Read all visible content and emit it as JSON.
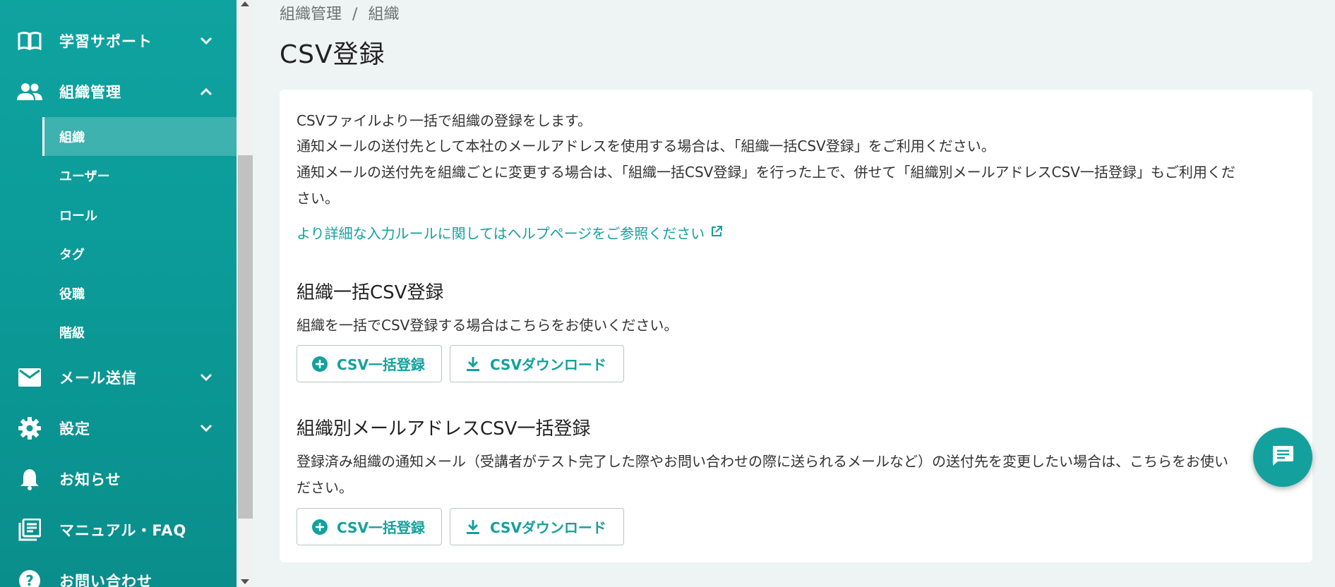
{
  "sidebar": {
    "groups": [
      {
        "label": "学習サポート",
        "icon": "book-icon",
        "expanded": false
      },
      {
        "label": "組織管理",
        "icon": "people-icon",
        "expanded": true
      },
      {
        "label": "メール送信",
        "icon": "mail-icon",
        "expanded": false
      },
      {
        "label": "設定",
        "icon": "gear-icon",
        "expanded": false
      },
      {
        "label": "お知らせ",
        "icon": "bell-icon"
      },
      {
        "label": "マニュアル・FAQ",
        "icon": "manual-icon"
      },
      {
        "label": "お問い合わせ",
        "icon": "help-icon"
      }
    ],
    "sub_items": [
      {
        "label": "組織",
        "active": true
      },
      {
        "label": "ユーザー"
      },
      {
        "label": "ロール"
      },
      {
        "label": "タグ"
      },
      {
        "label": "役職"
      },
      {
        "label": "階級"
      }
    ]
  },
  "breadcrumb": {
    "parent": "組織管理",
    "separator": "/",
    "current": "組織"
  },
  "page_title": "CSV登録",
  "intro": {
    "line1": "CSVファイルより一括で組織の登録をします。",
    "line2": "通知メールの送付先として本社のメールアドレスを使用する場合は、「組織一括CSV登録」をご利用ください。",
    "line3": "通知メールの送付先を組織ごとに変更する場合は、「組織一括CSV登録」を行った上で、併せて「組織別メールアドレスCSV一括登録」もご利用くだ",
    "line4": "さい。",
    "help_link": "より詳細な入力ルールに関してはヘルプページをご参照ください"
  },
  "section1": {
    "title": "組織一括CSV登録",
    "desc": "組織を一括でCSV登録する場合はこちらをお使いください。",
    "upload_label": "CSV一括登録",
    "download_label": "CSVダウンロード"
  },
  "section2": {
    "title": "組織別メールアドレスCSV一括登録",
    "desc_line1": "登録済み組織の通知メール（受講者がテスト完了した際やお問い合わせの際に送られるメールなど）の送付先を変更したい場合は、こちらをお使い",
    "desc_line2": "ださい。",
    "upload_label": "CSV一括登録",
    "download_label": "CSVダウンロード"
  },
  "colors": {
    "accent": "#14a19d",
    "sidebar": "#0fa3a0"
  }
}
